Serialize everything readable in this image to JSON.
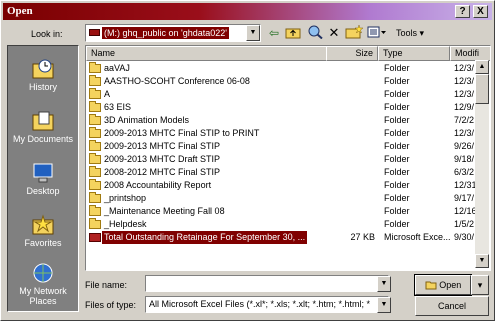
{
  "dialog": {
    "title": "Open"
  },
  "titlebar_buttons": {
    "help": "?",
    "close": "X"
  },
  "lookin": {
    "label": "Look in:",
    "value": "(M:) ghq_public on 'ghdata022'"
  },
  "toolbar": {
    "tools_label": "Tools"
  },
  "places": [
    {
      "label": "History"
    },
    {
      "label": "My Documents"
    },
    {
      "label": "Desktop"
    },
    {
      "label": "Favorites"
    },
    {
      "label": "My Network Places"
    }
  ],
  "columns": {
    "name": "Name",
    "size": "Size",
    "type": "Type",
    "modified": "Modifi"
  },
  "files": [
    {
      "name": "aaVAJ",
      "size": "",
      "type": "Folder",
      "modified": "12/3/",
      "icon": "folder-icon"
    },
    {
      "name": "AASTHO-SCOHT Conference 06-08",
      "size": "",
      "type": "Folder",
      "modified": "12/3/",
      "icon": "folder-icon"
    },
    {
      "name": "A",
      "size": "",
      "type": "Folder",
      "modified": "12/3/",
      "icon": "folder-icon"
    },
    {
      "name": "63 EIS",
      "size": "",
      "type": "Folder",
      "modified": "12/9/",
      "icon": "folder-icon"
    },
    {
      "name": "3D Animation Models",
      "size": "",
      "type": "Folder",
      "modified": "7/2/2",
      "icon": "folder-icon"
    },
    {
      "name": "2009-2013 MHTC Final STIP to PRINT",
      "size": "",
      "type": "Folder",
      "modified": "12/3/",
      "icon": "folder-icon"
    },
    {
      "name": "2009-2013 MHTC Final STIP",
      "size": "",
      "type": "Folder",
      "modified": "9/26/",
      "icon": "folder-icon"
    },
    {
      "name": "2009-2013 MHTC Draft STIP",
      "size": "",
      "type": "Folder",
      "modified": "9/18/",
      "icon": "folder-icon"
    },
    {
      "name": "2008-2012 MHTC Final STIP",
      "size": "",
      "type": "Folder",
      "modified": "6/3/2",
      "icon": "folder-icon"
    },
    {
      "name": "2008 Accountability Report",
      "size": "",
      "type": "Folder",
      "modified": "12/31",
      "icon": "folder-icon"
    },
    {
      "name": "_printshop",
      "size": "",
      "type": "Folder",
      "modified": "9/17/",
      "icon": "folder-icon"
    },
    {
      "name": "_Maintenance Meeting Fall 08",
      "size": "",
      "type": "Folder",
      "modified": "12/16",
      "icon": "folder-icon"
    },
    {
      "name": "_Helpdesk",
      "size": "",
      "type": "Folder",
      "modified": "1/5/2",
      "icon": "folder-icon"
    },
    {
      "name": "Total Outstanding Retainage For September 30, ...",
      "size": "27 KB",
      "type": "Microsoft Exce...",
      "modified": "9/30/",
      "icon": "excel-file-icon",
      "selected": true
    }
  ],
  "filename": {
    "label": "File name:",
    "value": ""
  },
  "filetype": {
    "label": "Files of type:",
    "value": "All Microsoft Excel Files (*.xl*; *.xls; *.xlt; *.htm; *.html; *"
  },
  "buttons": {
    "open": "Open",
    "cancel": "Cancel"
  }
}
